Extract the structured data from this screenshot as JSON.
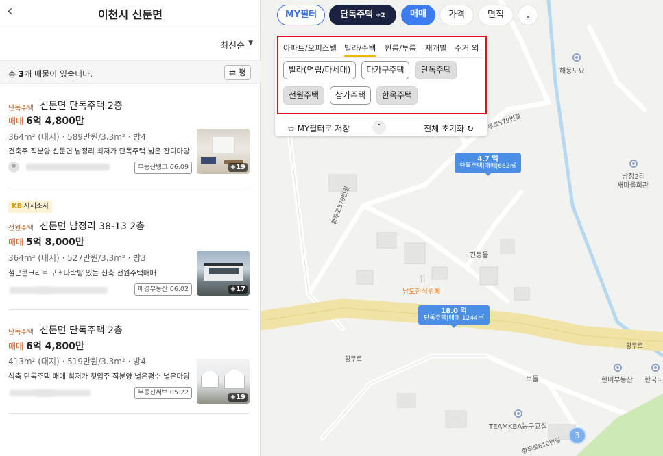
{
  "header": {
    "title": "이천시 신둔면",
    "back_icon": "‹"
  },
  "sort": {
    "label": "최신순",
    "caret": "▼"
  },
  "summary": {
    "prefix": "총 ",
    "count": "3",
    "suffix": "개 매물이 있습니다.",
    "unit_toggle_icon": "⇄",
    "unit_toggle": "평"
  },
  "listings": [
    {
      "type": "단독주택",
      "title": "신둔면 단독주택 2층",
      "deal": "매매",
      "price": "6억 4,800만",
      "spec": "364m² (대지) · 589만원/3.3m² · 방4",
      "desc": "건축주 직분양 신둔면 남정리 최저가 단독주택 넓은 잔디마당",
      "agent": "부동산뱅크 06.09",
      "photo_count": "+19"
    },
    {
      "kb_badge": "KB",
      "kb_label": "시세조사",
      "type": "전원주택",
      "title": "신둔면 남정리 38-13 2층",
      "deal": "매매",
      "price": "5억 8,000만",
      "spec": "364m² (대지) · 527만원/3.3m² · 방3",
      "desc": "철근콘크리트 구조다락방 있는 신축 전원주택매매",
      "agent": "매경부동산 06.02",
      "photo_count": "+17"
    },
    {
      "type": "단독주택",
      "title": "신둔면 단독주택 2층",
      "deal": "매매",
      "price": "6억 4,800만",
      "spec": "413m² (대지) · 519만원/3.3m² · 방4",
      "desc": "식축 단독주택 매매 최저가 첫입주 직분양 넓은평수 넓은마당",
      "agent": "부동산써브 05.22",
      "photo_count": "+19"
    }
  ],
  "filters": {
    "my_filter": "MY필터",
    "property_type": "단독주택",
    "property_type_extra": "+2",
    "deal": "매매",
    "price": "가격",
    "area": "면적",
    "more_icon": "⌄"
  },
  "panel": {
    "tabs": [
      "아파트/오피스텔",
      "빌라/주택",
      "원룸/투룸",
      "재개발",
      "주거 외"
    ],
    "options": [
      {
        "label": "빌라(연립/다세대)",
        "selected": false
      },
      {
        "label": "다가구주택",
        "selected": false
      },
      {
        "label": "단독주택",
        "selected": true
      },
      {
        "label": "전원주택",
        "selected": true
      },
      {
        "label": "상가주택",
        "selected": false
      },
      {
        "label": "한옥주택",
        "selected": true
      }
    ],
    "save_icon": "☆",
    "save_label": "MY필터로 저장",
    "collapse_icon": "⌃",
    "reset_label": "전체 초기화",
    "reset_icon": "↻"
  },
  "map": {
    "labels": {
      "haedong": "해동도요",
      "namjeong2ri": "남정2리",
      "namjeong_hall": "새마을회관",
      "road579_a": "황무로579번길",
      "road579_b": "황무로579번길",
      "gindeul": "긴등들",
      "restaurant": "남도한식뷔페",
      "restaurant_icon": "🍴",
      "hwangmuro_a": "황무로",
      "hwangmuro_b": "황무로",
      "bodeul": "보들",
      "hanmi": "한미부동산",
      "hanguk": "한국타",
      "teamkba": "TEAMKBA농구교실",
      "road610": "황무로610번길"
    },
    "pins": [
      {
        "price": "4.7 억",
        "detail": "단독주택|매매|682㎡"
      },
      {
        "price": "18.0 억",
        "detail": "단독주택|매매|1244㎡"
      }
    ],
    "cluster_count": "3",
    "colors": {
      "road": "#f1e2a6",
      "stream": "#b6d8f1",
      "pin": "#4a8ee6"
    }
  }
}
